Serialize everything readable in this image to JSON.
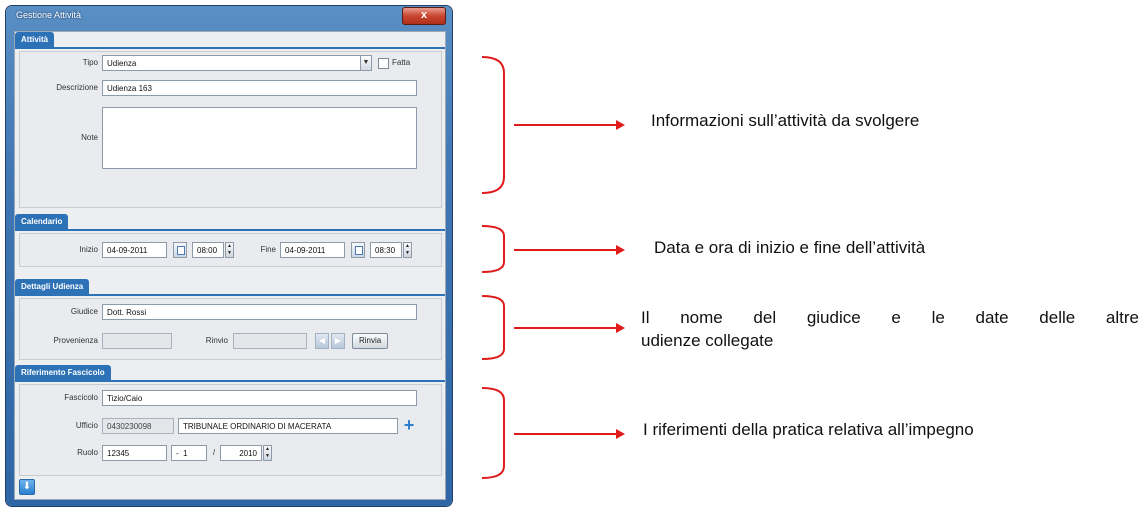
{
  "window": {
    "title": "Gestione Attività",
    "close": "x"
  },
  "attivita": {
    "section": "Attività",
    "tipo_label": "Tipo",
    "tipo_value": "Udienza",
    "fatta_label": "Fatta",
    "descrizione_label": "Descrizione",
    "descrizione_value": "Udienza 163",
    "note_label": "Note",
    "note_value": ""
  },
  "calendario": {
    "section": "Calendario",
    "inizio_label": "Inizio",
    "inizio_date": "04-09-2011",
    "inizio_time": "08:00",
    "fine_label": "Fine",
    "fine_date": "04-09-2011",
    "fine_time": "08:30"
  },
  "dettagli": {
    "section": "Dettagli Udienza",
    "giudice_label": "Giudice",
    "giudice_value": "Dott. Rossi",
    "provenienza_label": "Provenienza",
    "provenienza_value": "",
    "rinvio_label": "Rinvio",
    "rinvio_value": "",
    "rinvia_button": "Rinvia"
  },
  "riferimento": {
    "section": "Riferimento Fascicolo",
    "fascicolo_label": "Fascicolo",
    "fascicolo_value": "Tizio/Caio",
    "ufficio_label": "Ufficio",
    "ufficio_code": "0430230098",
    "ufficio_name": "TRIBUNALE ORDINARIO DI MACERATA",
    "ruolo_label": "Ruolo",
    "ruolo_number": "12345",
    "ruolo_sep1": "-",
    "ruolo_part": "1",
    "ruolo_sep2": "/",
    "ruolo_year": "2010"
  },
  "annotations": [
    "Informazioni sull’attività da svolgere",
    "Data e ora di inizio e fine dell’attività",
    "Il nome del giudice e le date delle altre",
    "udienze collegate",
    "I riferimenti della pratica relativa all’impegno"
  ],
  "colors": {
    "annotation_arrow": "#e01b1b",
    "section_header": "#2d72b7"
  }
}
